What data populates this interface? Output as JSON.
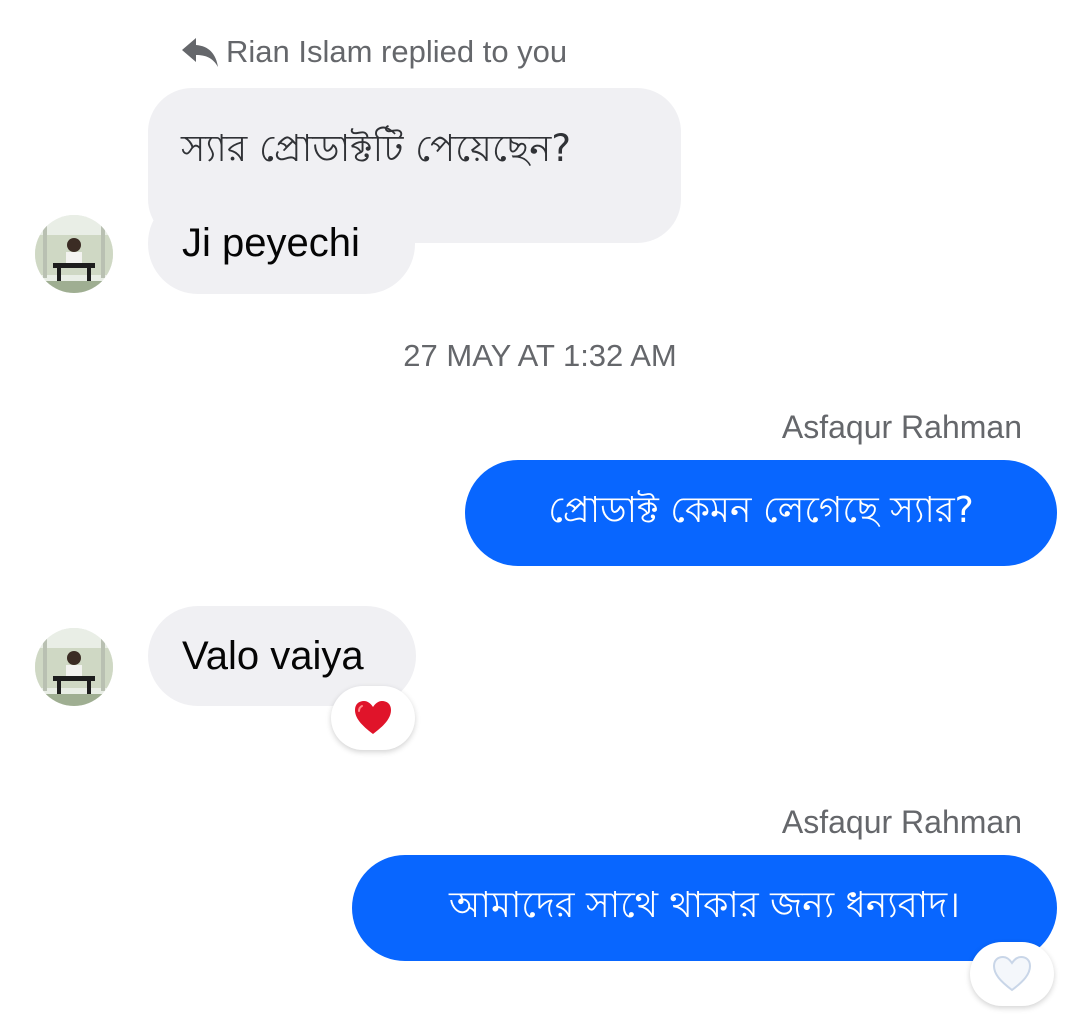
{
  "reply_context": {
    "header_text": "Rian Islam replied to you",
    "quoted_message": "স্যার প্রোডাক্টটি পেয়েছেন?"
  },
  "messages": {
    "incoming_reply": "Ji peyechi",
    "timestamp": "27 MAY AT 1:32 AM",
    "outgoing_1": {
      "sender": "Asfaqur Rahman",
      "text": "প্রোডাক্ট কেমন লেগেছে স্যার?"
    },
    "incoming_2": {
      "text": "Valo vaiya",
      "reaction": "heart-icon"
    },
    "outgoing_2": {
      "sender": "Asfaqur Rahman",
      "text": "আমাদের সাথে থাকার জন্য ধন্যবাদ।",
      "reaction": "heart-outline-icon"
    }
  },
  "colors": {
    "outgoing_bubble": "#0866ff",
    "incoming_bubble": "#f0f0f3",
    "meta_text": "#65676b",
    "heart": "#e0142a"
  }
}
